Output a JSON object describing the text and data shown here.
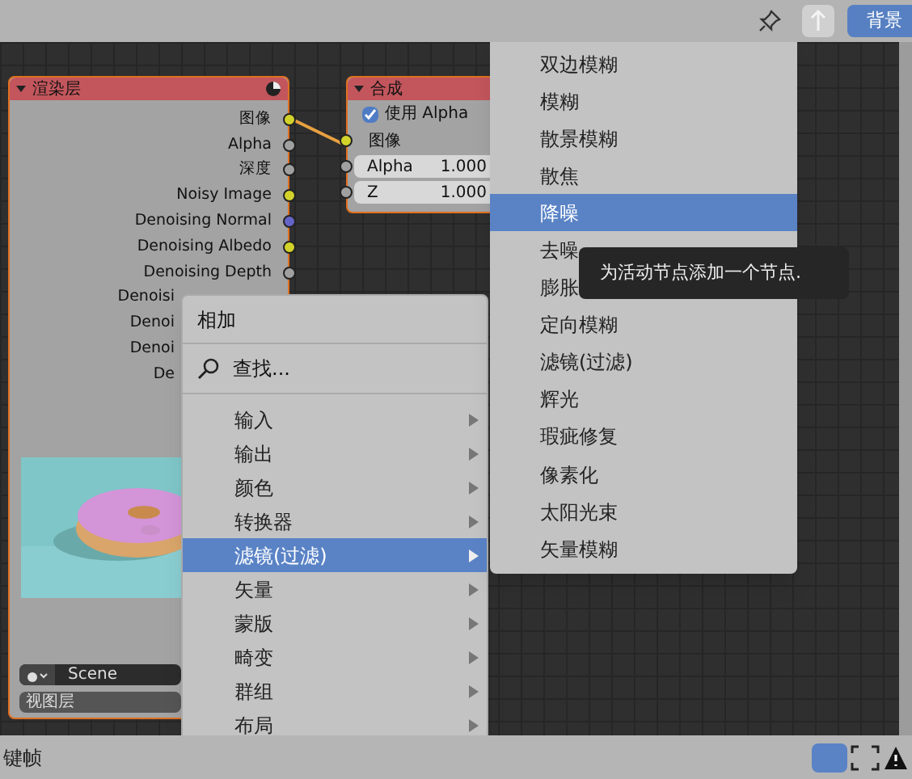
{
  "header": {
    "tab": {
      "label": "背景",
      "selected": true
    }
  },
  "render_node": {
    "title": "渲染层",
    "outputs": [
      {
        "label": "图像",
        "color": "#d2d22a"
      },
      {
        "label": "Alpha",
        "color": "#a0a0a0"
      },
      {
        "label": "深度",
        "color": "#a0a0a0"
      },
      {
        "label": "Noisy Image",
        "color": "#d2d22a"
      },
      {
        "label": "Denoising Normal",
        "color": "#6464c8"
      },
      {
        "label": "Denoising Albedo",
        "color": "#d2d22a"
      },
      {
        "label": "Denoising Depth",
        "color": "#a0a0a0"
      },
      {
        "label": "Denoisi"
      },
      {
        "label": "Denoi"
      },
      {
        "label": "Denoi"
      },
      {
        "label": "De"
      }
    ],
    "scene": "Scene",
    "view_layer": "视图层"
  },
  "composite_node": {
    "title": "合成",
    "use_alpha": {
      "label": "使用 Alpha",
      "checked": true
    },
    "image_input": "图像",
    "fields": [
      {
        "label": "Alpha",
        "value": "1.000"
      },
      {
        "label": "Z",
        "value": "1.000"
      }
    ]
  },
  "add_menu": {
    "title": "相加",
    "search": "查找...",
    "items": [
      {
        "label": "输入",
        "selected": false
      },
      {
        "label": "输出",
        "selected": false
      },
      {
        "label": "颜色",
        "selected": false
      },
      {
        "label": "转换器",
        "selected": false
      },
      {
        "label": "滤镜(过滤)",
        "selected": true
      },
      {
        "label": "矢量",
        "selected": false
      },
      {
        "label": "蒙版",
        "selected": false
      },
      {
        "label": "畸变",
        "selected": false
      },
      {
        "label": "群组",
        "selected": false
      },
      {
        "label": "布局",
        "selected": false
      }
    ]
  },
  "filter_submenu": {
    "items": [
      {
        "label": "双边模糊",
        "selected": false
      },
      {
        "label": "模糊",
        "selected": false
      },
      {
        "label": "散景模糊",
        "selected": false
      },
      {
        "label": "散焦",
        "selected": false
      },
      {
        "label": "降噪",
        "selected": true
      },
      {
        "label": "去噪",
        "selected": false
      },
      {
        "label": "膨胀",
        "selected": false
      },
      {
        "label": "定向模糊",
        "selected": false
      },
      {
        "label": "滤镜(过滤)",
        "selected": false
      },
      {
        "label": "辉光",
        "selected": false
      },
      {
        "label": "瑕疵修复",
        "selected": false
      },
      {
        "label": "像素化",
        "selected": false
      },
      {
        "label": "太阳光束",
        "selected": false
      },
      {
        "label": "矢量模糊",
        "selected": false
      }
    ]
  },
  "tooltip": "为活动节点添加一个节点.",
  "status_bar": {
    "text": "键帧"
  }
}
